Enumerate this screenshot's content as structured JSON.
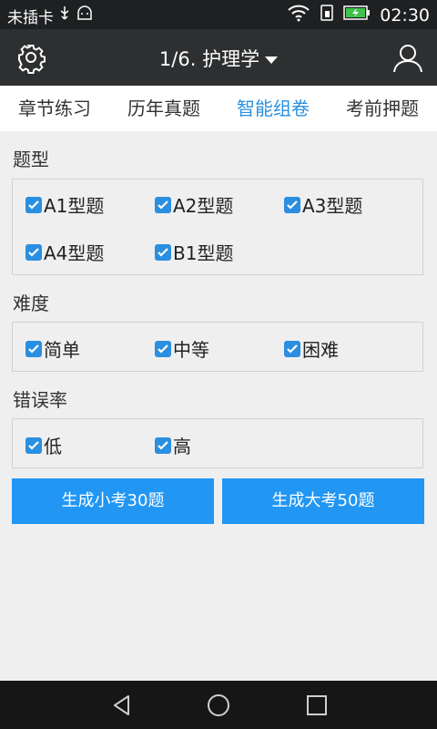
{
  "status_bar": {
    "carrier": "未插卡",
    "time": "02:30"
  },
  "header": {
    "title": "1/6. 护理学"
  },
  "tabs": [
    "章节练习",
    "历年真题",
    "智能组卷",
    "考前押题"
  ],
  "active_tab": 2,
  "sections": {
    "type": {
      "title": "题型",
      "options": [
        "A1型题",
        "A2型题",
        "A3型题",
        "A4型题",
        "B1型题"
      ]
    },
    "difficulty": {
      "title": "难度",
      "options": [
        "简单",
        "中等",
        "困难"
      ]
    },
    "error_rate": {
      "title": "错误率",
      "options": [
        "低",
        "高"
      ]
    }
  },
  "buttons": {
    "small_exam": "生成小考30题",
    "big_exam": "生成大考50题"
  },
  "colors": {
    "accent": "#2196f3",
    "header_bg": "#2d2f31",
    "status_bg": "#1e2022"
  }
}
